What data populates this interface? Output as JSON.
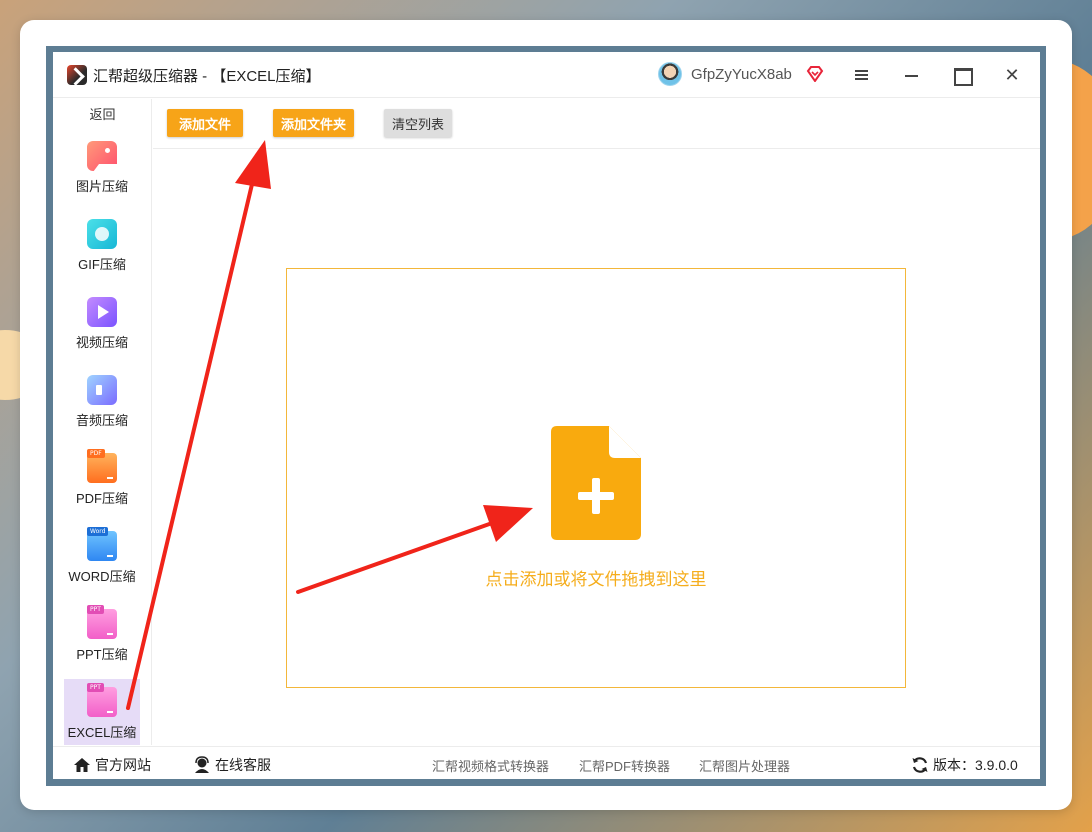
{
  "window": {
    "title": "汇帮超级压缩器  - 【EXCEL压缩】",
    "user_name": "GfpZyYucX8ab",
    "close_glyph": "✕"
  },
  "sidebar": {
    "back_label": "返回",
    "items": [
      {
        "label": "图片压缩",
        "icon": "image-icon"
      },
      {
        "label": "GIF压缩",
        "icon": "gif-icon"
      },
      {
        "label": "视频压缩",
        "icon": "video-icon"
      },
      {
        "label": "音频压缩",
        "icon": "audio-icon"
      },
      {
        "label": "PDF压缩",
        "icon": "pdf-icon",
        "tag": "PDF"
      },
      {
        "label": "WORD压缩",
        "icon": "word-icon",
        "tag": "Word"
      },
      {
        "label": "PPT压缩",
        "icon": "ppt-icon",
        "tag": "PPT"
      },
      {
        "label": "EXCEL压缩",
        "icon": "excel-icon",
        "tag": "PPT",
        "active": true
      }
    ]
  },
  "toolbar": {
    "add_file_label": "添加文件",
    "add_folder_label": "添加文件夹",
    "clear_list_label": "清空列表"
  },
  "dropzone": {
    "hint": "点击添加或将文件拖拽到这里"
  },
  "footer": {
    "official_site": "官方网站",
    "online_support": "在线客服",
    "links": [
      "汇帮视频格式转换器",
      "汇帮PDF转换器",
      "汇帮图片处理器"
    ],
    "version": "版本：3.9.0.0"
  },
  "colors": {
    "accent_orange": "#f7a418",
    "dropzone_border": "#f3b73a",
    "hint_text": "#f5ad1c",
    "active_item_bg": "#e6dcf7",
    "annotation_arrow": "#f0241a"
  }
}
